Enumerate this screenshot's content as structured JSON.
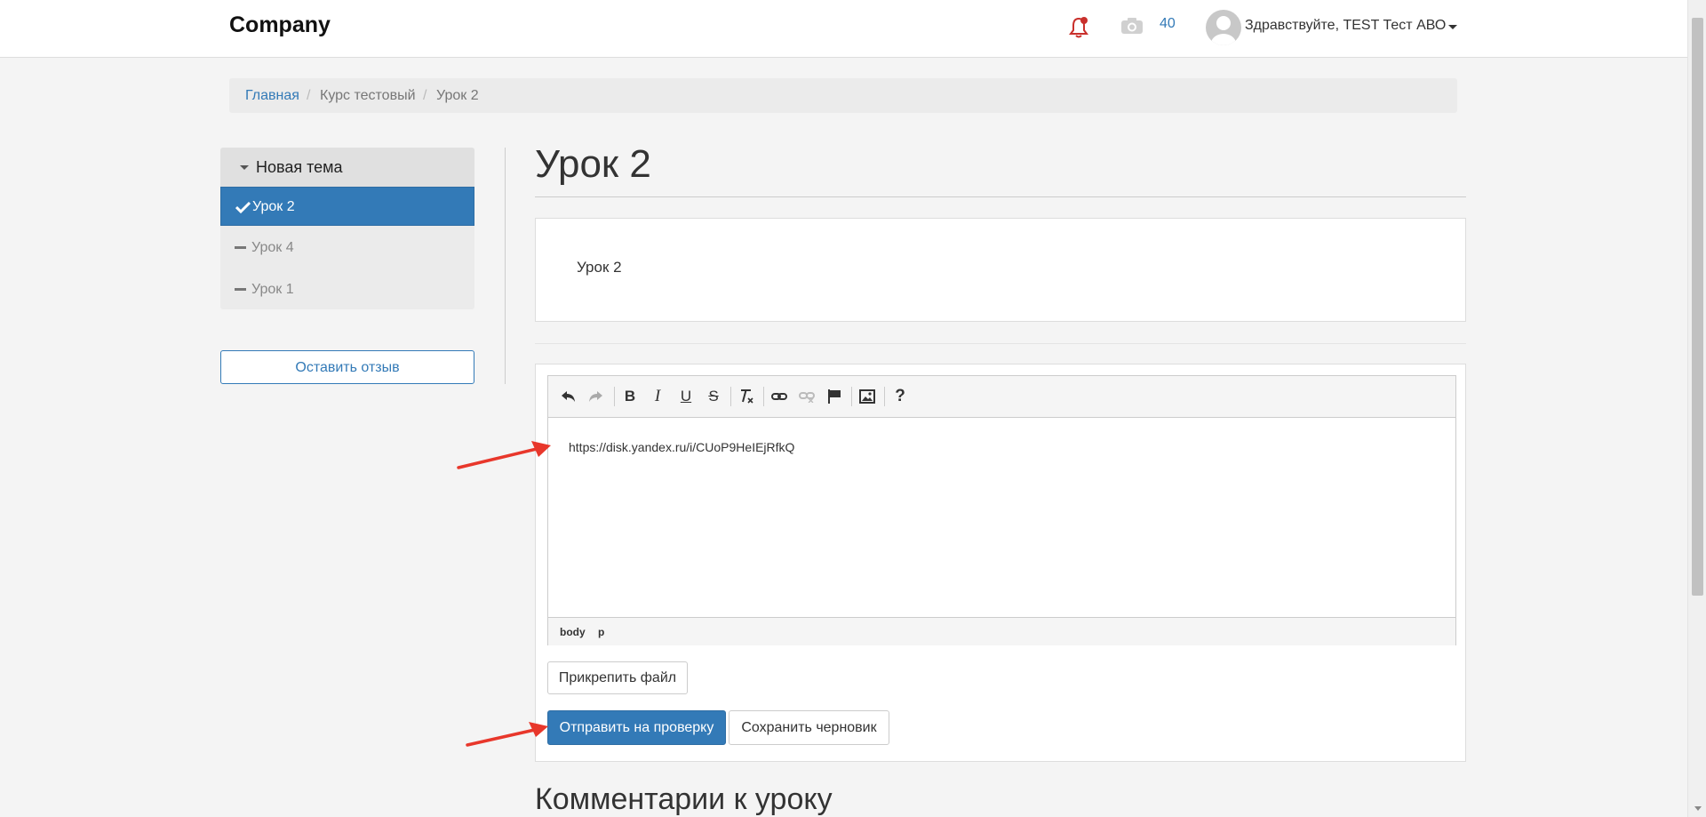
{
  "header": {
    "brand": "Company",
    "camera_count": "40",
    "greeting": "Здравствуйте, TEST Тест АВО"
  },
  "breadcrumb": {
    "home": "Главная",
    "separator": "/",
    "course": "Курс тестовый",
    "current": "Урок 2"
  },
  "sidebar": {
    "section_title": "Новая тема",
    "items": [
      {
        "label": "Урок 2",
        "state": "completed-active"
      },
      {
        "label": "Урок 4",
        "state": "pending"
      },
      {
        "label": "Урок 1",
        "state": "pending"
      }
    ],
    "feedback_button": "Оставить отзыв"
  },
  "main": {
    "title": "Урок 2",
    "lesson_content": "Урок 2",
    "editor": {
      "content": "https://disk.yandex.ru/i/CUoP9HeIEjRfkQ",
      "status_path": [
        "body",
        "p"
      ],
      "toolbar": [
        "undo-icon",
        "redo-icon",
        "bold-icon",
        "italic-icon",
        "underline-icon",
        "strikethrough-icon",
        "clear-format-icon",
        "link-icon",
        "unlink-icon",
        "anchor-flag-icon",
        "image-icon",
        "help-icon"
      ]
    },
    "attach_button": "Прикрепить файл",
    "submit_button": "Отправить на проверку",
    "draft_button": "Сохранить черновик",
    "comments_title": "Комментарии к уроку"
  },
  "colors": {
    "primary": "#337ab7",
    "notification": "#c9302c",
    "arrow": "#e8372b",
    "background": "#f4f4f4"
  }
}
